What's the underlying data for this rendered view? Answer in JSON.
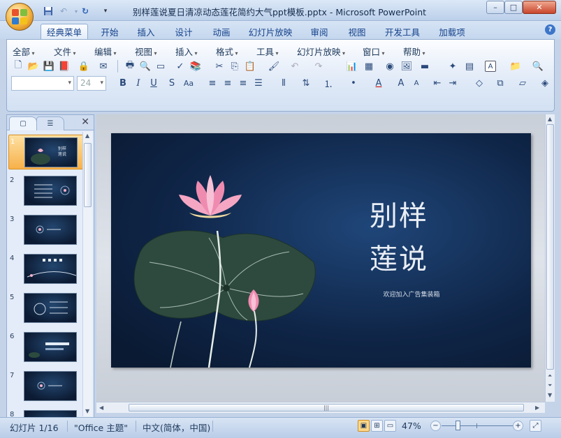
{
  "window": {
    "title": "别样莲说夏日清凉动态莲花简约大气ppt模板.pptx - Microsoft PowerPoint",
    "controls": {
      "minimize": "–",
      "maximize": "□",
      "close": "✕"
    }
  },
  "quick_access": [
    {
      "name": "save-icon",
      "glyph": "💾"
    },
    {
      "name": "undo-icon",
      "glyph": "↶"
    },
    {
      "name": "redo-icon",
      "glyph": "↻"
    },
    {
      "name": "qat-dropdown-icon",
      "glyph": "▾"
    }
  ],
  "tabs": [
    "经典菜单",
    "开始",
    "插入",
    "设计",
    "动画",
    "幻灯片放映",
    "审阅",
    "视图",
    "开发工具",
    "加载项"
  ],
  "active_tab": "经典菜单",
  "menu": [
    "全部",
    "文件",
    "编辑",
    "视图",
    "插入",
    "格式",
    "工具",
    "幻灯片放映",
    "窗口",
    "帮助"
  ],
  "toolbar": {
    "font_name": "",
    "font_size": "24"
  },
  "panel": {
    "tabs": [
      "slides-tab",
      "outline-tab"
    ],
    "close": "✕",
    "thumbnails": [
      "1",
      "2",
      "3",
      "4",
      "5",
      "6",
      "7",
      "8"
    ],
    "selected": "1",
    "thumb_title": "别样\n莲说"
  },
  "slide": {
    "title_line1": "别样",
    "title_line2": "莲说",
    "subtitle": "欢迎加入广告集装箱"
  },
  "status": {
    "slide_info": "幻灯片 1/16",
    "theme": "\"Office 主题\"",
    "language": "中文(简体，中国)",
    "zoom": "47%",
    "zoom_out": "−",
    "zoom_in": "+"
  },
  "colors": {
    "slide_bg": "#0f2547",
    "accent": "#f7b14a",
    "ribbon": "#dfe9f7"
  }
}
